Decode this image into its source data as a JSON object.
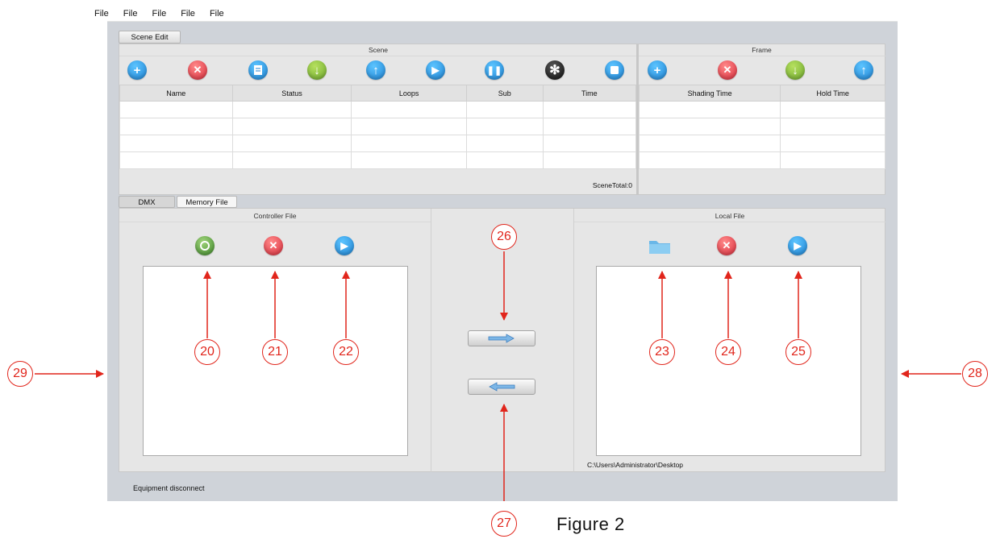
{
  "menu": [
    "File",
    "File",
    "File",
    "File",
    "File"
  ],
  "tabs": {
    "scene_edit": "Scene Edit",
    "dmx": "DMX",
    "memory_file": "Memory File"
  },
  "scene": {
    "title": "Scene",
    "columns": [
      "Name",
      "Status",
      "Loops",
      "Sub",
      "Time"
    ],
    "total": "SceneTotal:0",
    "toolbar_icons": [
      "add-icon",
      "delete-icon",
      "copy-icon",
      "move-down-icon",
      "move-up-icon",
      "play-icon",
      "pause-icon",
      "settings-icon",
      "stop-icon"
    ]
  },
  "frame": {
    "title": "Frame",
    "columns": [
      "Shading Time",
      "Hold Time"
    ],
    "toolbar_icons": [
      "add-icon",
      "delete-icon",
      "move-down-icon",
      "move-up-icon"
    ]
  },
  "controller_file": {
    "title": "Controller File",
    "icons": [
      "download-icon",
      "delete-icon",
      "play-icon"
    ]
  },
  "local_file": {
    "title": "Local File",
    "icons": [
      "folder-icon",
      "delete-icon",
      "play-icon"
    ],
    "path": "C:\\Users\\Administrator\\Desktop"
  },
  "transfer": {
    "right_icon": "arrow-right-icon",
    "left_icon": "arrow-left-icon"
  },
  "status": "Equipment disconnect",
  "callouts": [
    "20",
    "21",
    "22",
    "23",
    "24",
    "25",
    "26",
    "27",
    "28",
    "29"
  ],
  "caption": "Figure 2",
  "colors": {
    "annotation": "#e1251b",
    "icon_blue": "#1f83d3",
    "icon_red": "#d92b3a",
    "icon_green": "#6ea82d"
  }
}
